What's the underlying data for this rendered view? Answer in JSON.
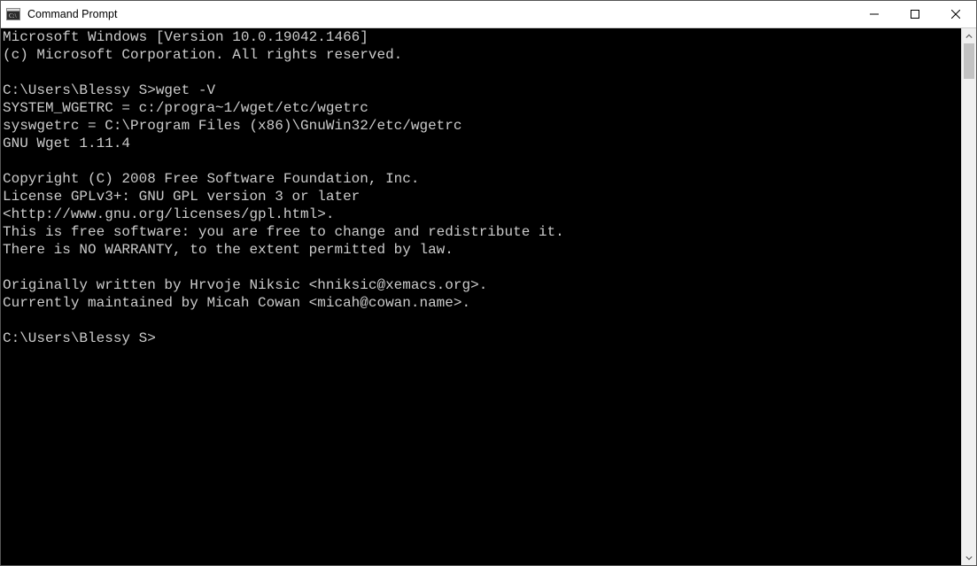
{
  "titlebar": {
    "title": "Command Prompt"
  },
  "terminal": {
    "lines": [
      "Microsoft Windows [Version 10.0.19042.1466]",
      "(c) Microsoft Corporation. All rights reserved.",
      "",
      "C:\\Users\\Blessy S>wget -V",
      "SYSTEM_WGETRC = c:/progra~1/wget/etc/wgetrc",
      "syswgetrc = C:\\Program Files (x86)\\GnuWin32/etc/wgetrc",
      "GNU Wget 1.11.4",
      "",
      "Copyright (C) 2008 Free Software Foundation, Inc.",
      "License GPLv3+: GNU GPL version 3 or later",
      "<http://www.gnu.org/licenses/gpl.html>.",
      "This is free software: you are free to change and redistribute it.",
      "There is NO WARRANTY, to the extent permitted by law.",
      "",
      "Originally written by Hrvoje Niksic <hniksic@xemacs.org>.",
      "Currently maintained by Micah Cowan <micah@cowan.name>.",
      "",
      "C:\\Users\\Blessy S>"
    ]
  }
}
